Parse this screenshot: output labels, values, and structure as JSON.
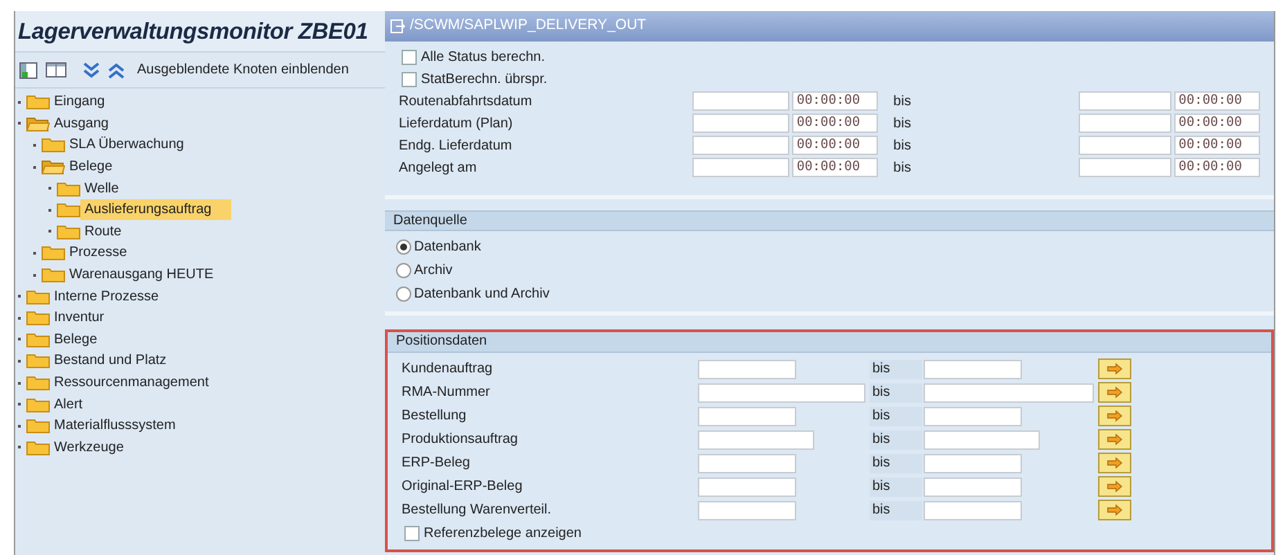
{
  "app_title": "Lagerverwaltungsmonitor ZBE01",
  "toolbar": {
    "hidden_nodes_button": "Ausgeblendete Knoten einblenden"
  },
  "tree": [
    {
      "label": "Eingang",
      "expanded": false,
      "selected": false
    },
    {
      "label": "Ausgang",
      "expanded": true,
      "selected": false,
      "children": [
        {
          "label": "SLA Überwachung",
          "expanded": false,
          "selected": false
        },
        {
          "label": "Belege",
          "expanded": true,
          "selected": false,
          "children": [
            {
              "label": "Welle",
              "expanded": false,
              "selected": false
            },
            {
              "label": "Auslieferungsauftrag",
              "expanded": false,
              "selected": true
            },
            {
              "label": "Route",
              "expanded": false,
              "selected": false
            }
          ]
        },
        {
          "label": "Prozesse",
          "expanded": false,
          "selected": false
        },
        {
          "label": "Warenausgang HEUTE",
          "expanded": false,
          "selected": false
        }
      ]
    },
    {
      "label": "Interne Prozesse",
      "expanded": false,
      "selected": false
    },
    {
      "label": "Inventur",
      "expanded": false,
      "selected": false
    },
    {
      "label": "Belege",
      "expanded": false,
      "selected": false
    },
    {
      "label": "Bestand und Platz",
      "expanded": false,
      "selected": false
    },
    {
      "label": "Ressourcenmanagement",
      "expanded": false,
      "selected": false
    },
    {
      "label": "Alert",
      "expanded": false,
      "selected": false
    },
    {
      "label": "Materialflusssystem",
      "expanded": false,
      "selected": false
    },
    {
      "label": "Werkzeuge",
      "expanded": false,
      "selected": false
    }
  ],
  "program_title": "/SCWM/SAPLWIP_DELIVERY_OUT",
  "status_options": [
    {
      "label": "Alle Status berechn.",
      "checked": false
    },
    {
      "label": "StatBerechn. übrspr.",
      "checked": false
    }
  ],
  "date_ranges": [
    {
      "label": "Routenabfahrtsdatum",
      "from_time": "00:00:00",
      "to_label": "bis",
      "to_time": "00:00:00"
    },
    {
      "label": "Lieferdatum (Plan)",
      "from_time": "00:00:00",
      "to_label": "bis",
      "to_time": "00:00:00"
    },
    {
      "label": "Endg. Lieferdatum",
      "from_time": "00:00:00",
      "to_label": "bis",
      "to_time": "00:00:00"
    },
    {
      "label": "Angelegt am",
      "from_time": "00:00:00",
      "to_label": "bis",
      "to_time": "00:00:00"
    }
  ],
  "data_source": {
    "title": "Datenquelle",
    "options": [
      {
        "label": "Datenbank",
        "selected": true
      },
      {
        "label": "Archiv",
        "selected": false
      },
      {
        "label": "Datenbank und Archiv",
        "selected": false
      }
    ]
  },
  "position_data": {
    "title": "Positionsdaten",
    "rows": [
      {
        "label": "Kundenauftrag",
        "to_label": "bis",
        "kind": "short"
      },
      {
        "label": "RMA-Nummer",
        "to_label": "bis",
        "kind": "long"
      },
      {
        "label": "Bestellung",
        "to_label": "bis",
        "kind": "short"
      },
      {
        "label": "Produktionsauftrag",
        "to_label": "bis",
        "kind": "medium"
      },
      {
        "label": "ERP-Beleg",
        "to_label": "bis",
        "kind": "short"
      },
      {
        "label": "Original-ERP-Beleg",
        "to_label": "bis",
        "kind": "short"
      },
      {
        "label": "Bestellung Warenverteil.",
        "to_label": "bis",
        "kind": "short"
      }
    ],
    "checkbox": {
      "label": "Referenzbelege anzeigen",
      "checked": false
    }
  }
}
